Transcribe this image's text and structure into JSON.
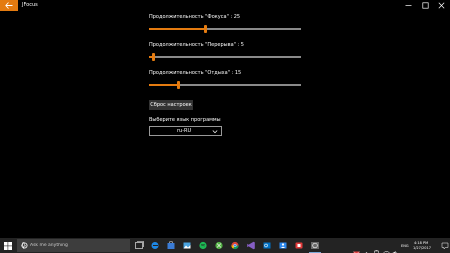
{
  "window": {
    "title": "JFocus",
    "accent": "#e47b10"
  },
  "settings": {
    "focus": {
      "label": "Продолжительность \"Фокуса\" : 25",
      "value": 25,
      "fraction": 0.37
    },
    "break": {
      "label": "Продолжительность \"Перерыва\" : 5",
      "value": 5,
      "fraction": 0.02
    },
    "rest": {
      "label": "Продолжительность \"Отдыха\" : 15",
      "value": 15,
      "fraction": 0.19
    }
  },
  "reset_button": "Сброс настроек",
  "language": {
    "label": "Выберите язык программы",
    "selected": "ru-RU"
  },
  "taskbar": {
    "search_placeholder": "Ask me anything",
    "pinned_icons": [
      "task-view-icon",
      "edge-icon",
      "store-icon",
      "photos-icon",
      "spotify-icon",
      "xbox-icon",
      "chrome-icon",
      "visual-studio-icon",
      "outlook-icon",
      "people-icon",
      "red-app-icon",
      "jfocus-icon"
    ],
    "tray": {
      "language": "ENG",
      "time": "4:18 PM",
      "date": "1/27/2017"
    }
  }
}
